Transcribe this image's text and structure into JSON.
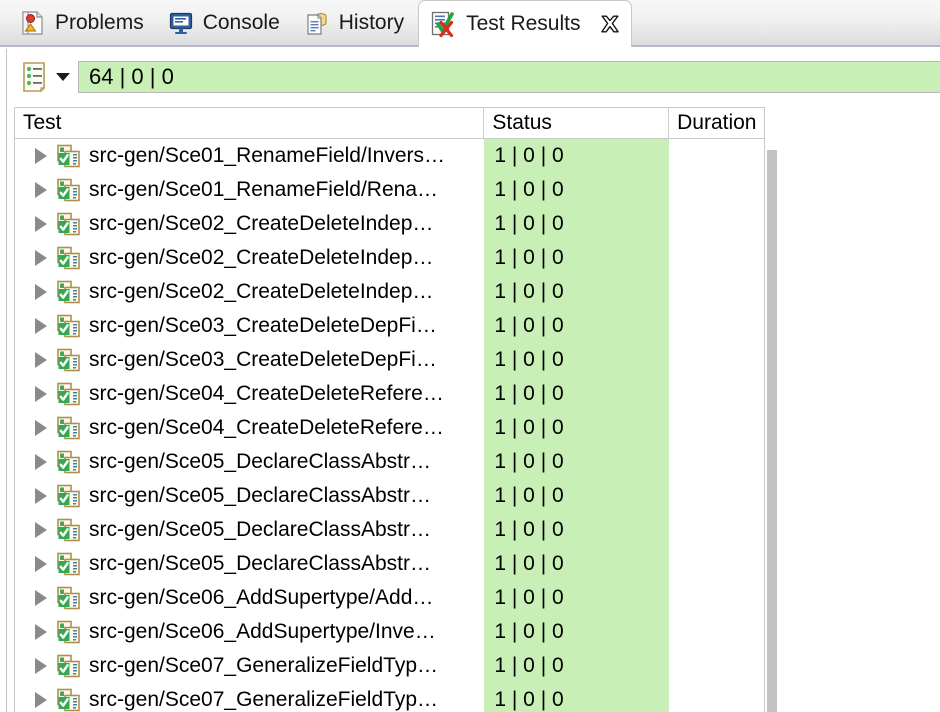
{
  "window": {
    "tabs": [
      {
        "label": "Problems",
        "icon": "problems-icon",
        "active": false
      },
      {
        "label": "Console",
        "icon": "console-icon",
        "active": false
      },
      {
        "label": "History",
        "icon": "history-icon",
        "active": false
      },
      {
        "label": "Test Results",
        "icon": "test-results-icon",
        "active": true
      }
    ],
    "close_icon": "close-icon"
  },
  "toolbar": {
    "view_menu_icon": "test-report-list-icon",
    "dropdown_icon": "chevron-down-icon",
    "summary": "64 | 0 | 0",
    "summary_color": "#c8efb5"
  },
  "table": {
    "columns": [
      {
        "key": "test",
        "label": "Test"
      },
      {
        "key": "status",
        "label": "Status"
      },
      {
        "key": "duration",
        "label": "Duration"
      }
    ],
    "status_cell_color": "#c8efb5",
    "row_icon": "test-case-passed-icon",
    "expander_icon": "chevron-right-icon",
    "rows": [
      {
        "test": "src-gen/Sce01_RenameField/Invers…",
        "status": "1 | 0 | 0",
        "duration": ""
      },
      {
        "test": "src-gen/Sce01_RenameField/Rena…",
        "status": "1 | 0 | 0",
        "duration": ""
      },
      {
        "test": "src-gen/Sce02_CreateDeleteIndep…",
        "status": "1 | 0 | 0",
        "duration": ""
      },
      {
        "test": "src-gen/Sce02_CreateDeleteIndep…",
        "status": "1 | 0 | 0",
        "duration": ""
      },
      {
        "test": "src-gen/Sce02_CreateDeleteIndep…",
        "status": "1 | 0 | 0",
        "duration": ""
      },
      {
        "test": "src-gen/Sce03_CreateDeleteDepFi…",
        "status": "1 | 0 | 0",
        "duration": ""
      },
      {
        "test": "src-gen/Sce03_CreateDeleteDepFi…",
        "status": "1 | 0 | 0",
        "duration": ""
      },
      {
        "test": "src-gen/Sce04_CreateDeleteRefere…",
        "status": "1 | 0 | 0",
        "duration": ""
      },
      {
        "test": "src-gen/Sce04_CreateDeleteRefere…",
        "status": "1 | 0 | 0",
        "duration": ""
      },
      {
        "test": "src-gen/Sce05_DeclareClassAbstr…",
        "status": "1 | 0 | 0",
        "duration": ""
      },
      {
        "test": "src-gen/Sce05_DeclareClassAbstr…",
        "status": "1 | 0 | 0",
        "duration": ""
      },
      {
        "test": "src-gen/Sce05_DeclareClassAbstr…",
        "status": "1 | 0 | 0",
        "duration": ""
      },
      {
        "test": "src-gen/Sce05_DeclareClassAbstr…",
        "status": "1 | 0 | 0",
        "duration": ""
      },
      {
        "test": "src-gen/Sce06_AddSupertype/Add…",
        "status": "1 | 0 | 0",
        "duration": ""
      },
      {
        "test": "src-gen/Sce06_AddSupertype/Inve…",
        "status": "1 | 0 | 0",
        "duration": ""
      },
      {
        "test": "src-gen/Sce07_GeneralizeFieldTyp…",
        "status": "1 | 0 | 0",
        "duration": ""
      },
      {
        "test": "src-gen/Sce07_GeneralizeFieldTyp…",
        "status": "1 | 0 | 0",
        "duration": ""
      }
    ]
  }
}
